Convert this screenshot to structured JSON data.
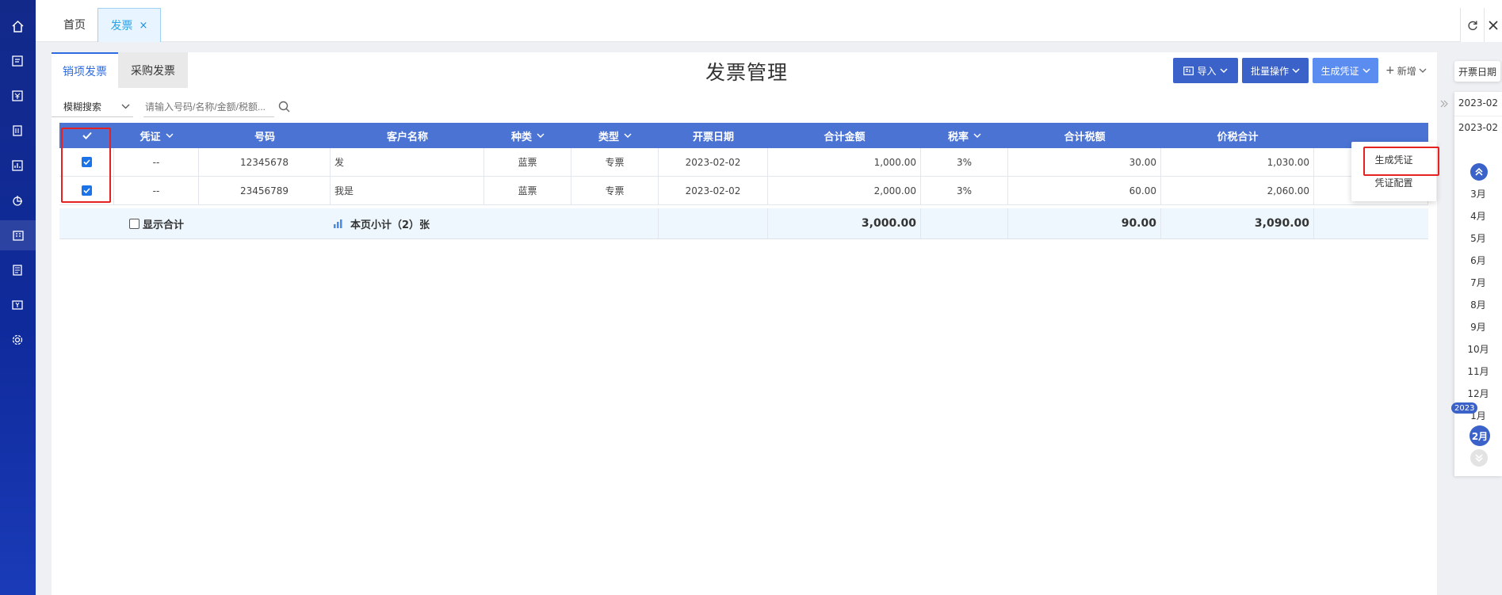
{
  "topbar": {
    "tabs": [
      {
        "label": "首页"
      },
      {
        "label": "发票",
        "close": "×"
      }
    ]
  },
  "sidebar": {
    "icons": [
      "home-icon",
      "document-icon",
      "yen-icon",
      "ledger-icon",
      "report-icon",
      "pie-icon",
      "building-icon",
      "invoice-icon",
      "yen-card-icon",
      "gear-icon"
    ]
  },
  "main": {
    "subtabs": [
      "销项发票",
      "采购发票"
    ],
    "title": "发票管理",
    "actions": {
      "import_label": "导入",
      "batch_label": "批量操作",
      "generate_label": "生成凭证",
      "add_label": "新增",
      "add_prefix": "+"
    },
    "search": {
      "mode": "模糊搜索",
      "placeholder": "请输入号码/名称/金额/税额..."
    }
  },
  "table": {
    "columns": [
      "凭证",
      "号码",
      "客户名称",
      "种类",
      "类型",
      "开票日期",
      "合计金额",
      "税率",
      "合计税额",
      "价税合计"
    ],
    "rows": [
      {
        "voucher": "--",
        "number": "12345678",
        "customer": "发",
        "kind": "蓝票",
        "type": "专票",
        "date": "2023-02-02",
        "amount": "1,000.00",
        "rate": "3%",
        "tax": "30.00",
        "total": "1,030.00"
      },
      {
        "voucher": "--",
        "number": "23456789",
        "customer": "我是",
        "kind": "蓝票",
        "type": "专票",
        "date": "2023-02-02",
        "amount": "2,000.00",
        "rate": "3%",
        "tax": "60.00",
        "total": "2,060.00"
      }
    ],
    "summary": {
      "show_total_label": "显示合计",
      "subtotal_label": "本页小计（2）张",
      "amount": "3,000.00",
      "tax": "90.00",
      "total": "3,090.00"
    }
  },
  "dropdown": {
    "items": [
      "生成凭证",
      "凭证配置"
    ]
  },
  "date_panel": {
    "tag": "开票日期",
    "start": "2023-02",
    "end": "2023-02",
    "months": [
      "3月",
      "4月",
      "5月",
      "6月",
      "7月",
      "8月",
      "9月",
      "10月",
      "11月",
      "12月",
      "1月"
    ],
    "year_badge": "2023",
    "current_month": "2月"
  },
  "colors": {
    "accent": "#3a62c9",
    "header": "#4b73d3",
    "highlight": "#e52222"
  }
}
